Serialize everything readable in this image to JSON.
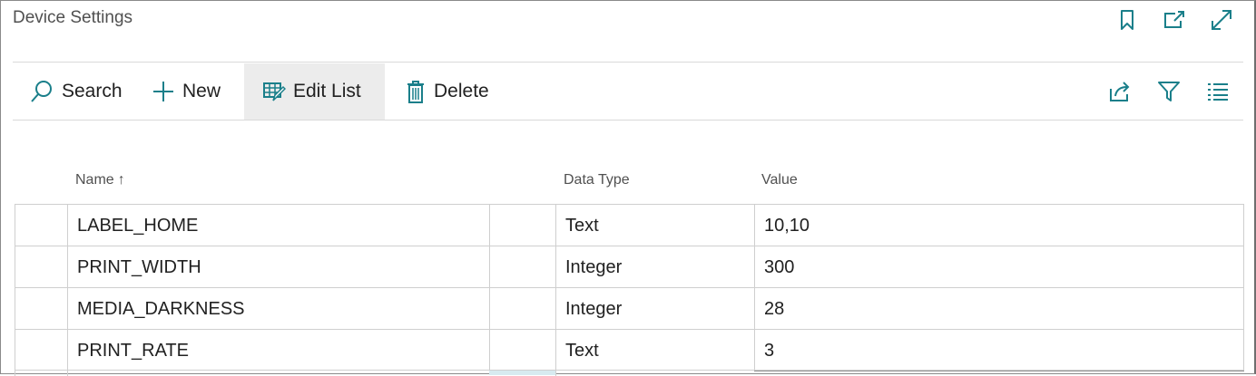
{
  "page": {
    "title": "Device Settings"
  },
  "header_actions": [
    {
      "name": "bookmark-icon"
    },
    {
      "name": "open-new-window-icon"
    },
    {
      "name": "expand-icon"
    }
  ],
  "toolbar": {
    "search_label": "Search",
    "new_label": "New",
    "edit_list_label": "Edit List",
    "delete_label": "Delete"
  },
  "right_tools": [
    {
      "name": "share-icon"
    },
    {
      "name": "filter-icon"
    },
    {
      "name": "list-view-icon"
    }
  ],
  "columns": {
    "name": "Name",
    "sort_indicator": "↑",
    "data_type": "Data Type",
    "value": "Value"
  },
  "rows": [
    {
      "name": "LABEL_HOME",
      "data_type": "Text",
      "value": "10,10"
    },
    {
      "name": "PRINT_WIDTH",
      "data_type": "Integer",
      "value": "300"
    },
    {
      "name": "MEDIA_DARKNESS",
      "data_type": "Integer",
      "value": "28"
    },
    {
      "name": "PRINT_RATE",
      "data_type": "Text",
      "value": "3"
    }
  ],
  "colors": {
    "accent": "#1a7f8a",
    "active_button_bg": "#ececec",
    "border": "#cfcfcf"
  }
}
